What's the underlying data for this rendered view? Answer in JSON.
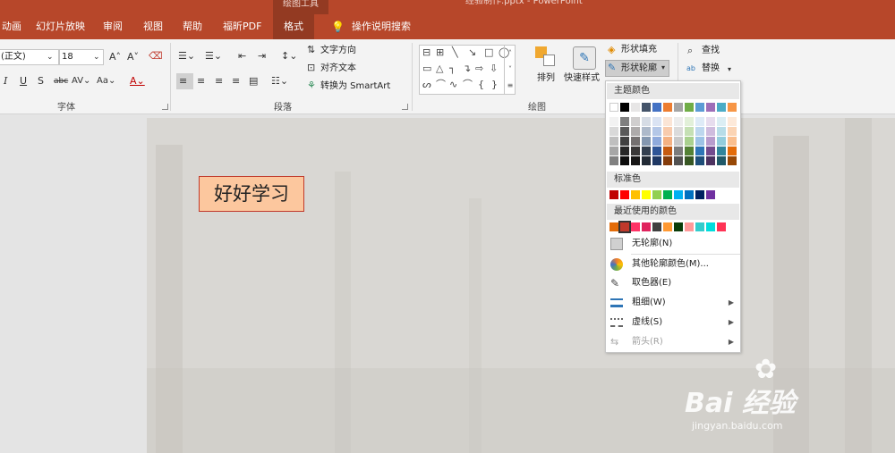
{
  "window": {
    "context_tab": "绘图工具",
    "title": "经验制作.pptx - PowerPoint"
  },
  "tabs": [
    "动画",
    "幻灯片放映",
    "审阅",
    "视图",
    "帮助",
    "福昕PDF",
    "格式",
    "操作说明搜索"
  ],
  "ribbon": {
    "font": {
      "name": "(正文)",
      "size": "18",
      "group": "字体"
    },
    "paragraph": {
      "text_direction": "文字方向",
      "align_text": "对齐文本",
      "smartart": "转换为 SmartArt",
      "group": "段落"
    },
    "drawing": {
      "arrange": "排列",
      "quick_styles": "快速样式",
      "group": "绘图"
    },
    "shape_fill": "形状填充",
    "shape_outline": "形状轮廓",
    "find": "查找",
    "replace": "替换"
  },
  "slide": {
    "textbox": "好好学习"
  },
  "watermark": {
    "brand": "Bai 经验",
    "url": "jingyan.baidu.com"
  },
  "dropdown": {
    "theme_colors_label": "主题颜色",
    "theme_top": [
      "#ffffff",
      "#000000",
      "#e7e6e6",
      "#44546a",
      "#4472c4",
      "#ed7d31",
      "#a5a5a5",
      "#70ad47",
      "#5b9bd5",
      "#9e6fb8",
      "#4bacc6",
      "#f79646"
    ],
    "theme_cols": [
      [
        "#f2f2f2",
        "#d9d9d9",
        "#bfbfbf",
        "#a6a6a6",
        "#808080"
      ],
      [
        "#7f7f7f",
        "#595959",
        "#404040",
        "#262626",
        "#0d0d0d"
      ],
      [
        "#d0cece",
        "#aeabab",
        "#757171",
        "#3a3838",
        "#171616"
      ],
      [
        "#d6dce5",
        "#adb9ca",
        "#8497b0",
        "#333f50",
        "#222a35"
      ],
      [
        "#dae3f3",
        "#b4c7e7",
        "#8faadc",
        "#2f5597",
        "#1f3864"
      ],
      [
        "#fbe5d6",
        "#f8cbad",
        "#f4b183",
        "#c55a11",
        "#843c0c"
      ],
      [
        "#ededed",
        "#dbdbdb",
        "#c9c9c9",
        "#7b7b7b",
        "#525252"
      ],
      [
        "#e2f0d9",
        "#c5e0b4",
        "#a9d18e",
        "#548235",
        "#385723"
      ],
      [
        "#deebf7",
        "#bdd7ee",
        "#9dc3e6",
        "#2e75b6",
        "#1f4e79"
      ],
      [
        "#e7ddee",
        "#cfbcde",
        "#b89ccd",
        "#734b8e",
        "#4c3260"
      ],
      [
        "#dbeef4",
        "#b7dde8",
        "#93cddd",
        "#31859c",
        "#215968"
      ],
      [
        "#fde9d9",
        "#fbd4b4",
        "#fabf8f",
        "#e46c0a",
        "#974806"
      ]
    ],
    "standard_label": "标准色",
    "standard": [
      "#c00000",
      "#ff0000",
      "#ffc000",
      "#ffff00",
      "#92d050",
      "#00b050",
      "#00b0f0",
      "#0070c0",
      "#002060",
      "#7030a0"
    ],
    "recent_label": "最近使用的颜色",
    "recent": [
      "#e36c0a",
      "#c0392b",
      "#ff3366",
      "#e0245e",
      "#404040",
      "#ff9933",
      "#0b3d0b",
      "#ff9999",
      "#33cccc",
      "#00dddd",
      "#ff3355"
    ],
    "items": [
      {
        "label": "无轮廓(N)",
        "icon": "no-outline-icon",
        "arrow": ""
      },
      {
        "label": "其他轮廓颜色(M)...",
        "icon": "color-wheel-icon",
        "arrow": ""
      },
      {
        "label": "取色器(E)",
        "icon": "eyedropper-icon",
        "arrow": ""
      },
      {
        "label": "粗细(W)",
        "icon": "weight-icon",
        "arrow": "▶"
      },
      {
        "label": "虚线(S)",
        "icon": "dashes-icon",
        "arrow": "▶"
      },
      {
        "label": "箭头(R)",
        "icon": "arrows-icon",
        "arrow": "▶"
      }
    ]
  }
}
